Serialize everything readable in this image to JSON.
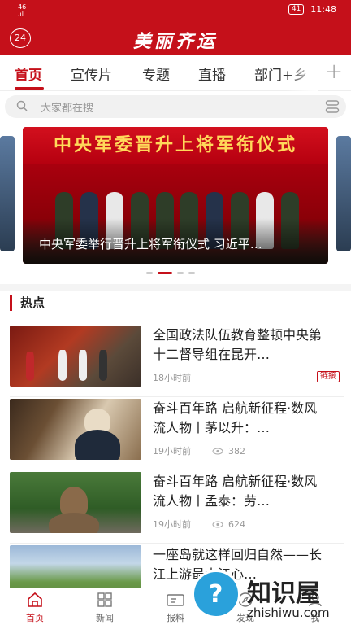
{
  "status_bar": {
    "signal": "46\n.ıl",
    "battery": "41",
    "time": "11:48"
  },
  "header": {
    "badge": "24",
    "title": "美丽齐运"
  },
  "tabs": [
    {
      "label": "首页",
      "active": true
    },
    {
      "label": "宣传片",
      "active": false
    },
    {
      "label": "专题",
      "active": false
    },
    {
      "label": "直播",
      "active": false
    },
    {
      "label": "部门+乡",
      "active": false
    }
  ],
  "search": {
    "placeholder": "大家都在搜"
  },
  "banner": {
    "headline": "中央军委晋升上将军衔仪式",
    "caption": "中央军委举行晋升上将军衔仪式 习近平…",
    "slides": 4,
    "active_slide": 1
  },
  "section": {
    "title": "热点"
  },
  "news": [
    {
      "title": "全国政法队伍教育整顿中央第十二督导组在昆开…",
      "time": "18小时前",
      "views": "",
      "tag": "链接"
    },
    {
      "title": "奋斗百年路 启航新征程·数风流人物丨茅以升：…",
      "time": "19小时前",
      "views": "382",
      "tag": ""
    },
    {
      "title": "奋斗百年路 启航新征程·数风流人物丨孟泰：劳…",
      "time": "19小时前",
      "views": "624",
      "tag": ""
    },
    {
      "title": "一座岛就这样回归自然——长江上游最大江心…",
      "time": "",
      "views": "",
      "tag": ""
    }
  ],
  "bottom_nav": [
    {
      "label": "首页",
      "active": true
    },
    {
      "label": "新闻",
      "active": false
    },
    {
      "label": "报料",
      "active": false
    },
    {
      "label": "发现",
      "active": false
    },
    {
      "label": "我",
      "active": false
    }
  ],
  "watermark": {
    "cn": "知识屋",
    "en": "zhishiwu.com",
    "mark": "?"
  },
  "colors": {
    "brand": "#c5101a"
  }
}
